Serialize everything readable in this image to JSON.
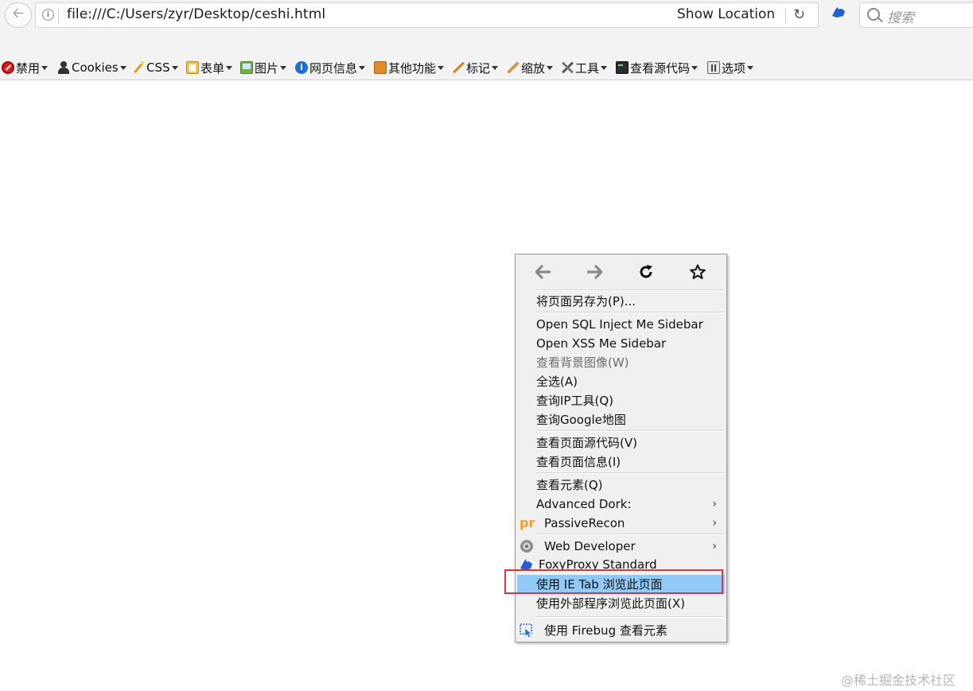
{
  "urlbar": {
    "url": "file:///C:/Users/zyr/Desktop/ceshi.html",
    "show_location": "Show Location",
    "search_placeholder": "搜索"
  },
  "toolbar": {
    "items": [
      {
        "label": "禁用",
        "icon": "disable-icon"
      },
      {
        "label": "Cookies",
        "icon": "cookies-icon"
      },
      {
        "label": "CSS",
        "icon": "css-icon"
      },
      {
        "label": "表单",
        "icon": "forms-icon"
      },
      {
        "label": "图片",
        "icon": "images-icon"
      },
      {
        "label": "网页信息",
        "icon": "information-icon"
      },
      {
        "label": "其他功能",
        "icon": "miscellaneous-icon"
      },
      {
        "label": "标记",
        "icon": "outline-icon"
      },
      {
        "label": "缩放",
        "icon": "resize-icon"
      },
      {
        "label": "工具",
        "icon": "tools-icon"
      },
      {
        "label": "查看源代码",
        "icon": "view-source-icon"
      },
      {
        "label": "选项",
        "icon": "options-icon"
      }
    ]
  },
  "context_menu": {
    "nav": [
      "back-icon",
      "forward-icon",
      "reload-icon",
      "bookmark-star-icon"
    ],
    "items": [
      {
        "label": "将页面另存为(P)..."
      },
      {
        "label": "Open SQL Inject Me Sidebar"
      },
      {
        "label": "Open XSS Me Sidebar"
      },
      {
        "label": "查看背景图像(W)",
        "disabled": true
      },
      {
        "label": "全选(A)"
      },
      {
        "label": "查询IP工具(Q)"
      },
      {
        "label": "查询Google地图"
      },
      {
        "label": "查看页面源代码(V)"
      },
      {
        "label": "查看页面信息(I)"
      },
      {
        "label": "查看元素(Q)"
      },
      {
        "label": "Advanced Dork:",
        "submenu": true
      },
      {
        "label": "PassiveRecon",
        "submenu": true,
        "icon": "passiverecon-icon"
      },
      {
        "label": "Web Developer",
        "submenu": true,
        "icon": "web-developer-icon"
      },
      {
        "label": "FoxyProxy Standard",
        "icon": "foxyproxy-icon"
      },
      {
        "label": "使用 IE Tab 浏览此页面",
        "highlighted": true
      },
      {
        "label": "使用外部程序浏览此页面(X)"
      },
      {
        "label": "使用 Firebug 查看元素",
        "icon": "firebug-inspect-icon"
      }
    ],
    "highlight_color": "#91c9f7",
    "annotation_box_color": "#d9363e"
  },
  "watermark": "@稀土掘金技术社区"
}
